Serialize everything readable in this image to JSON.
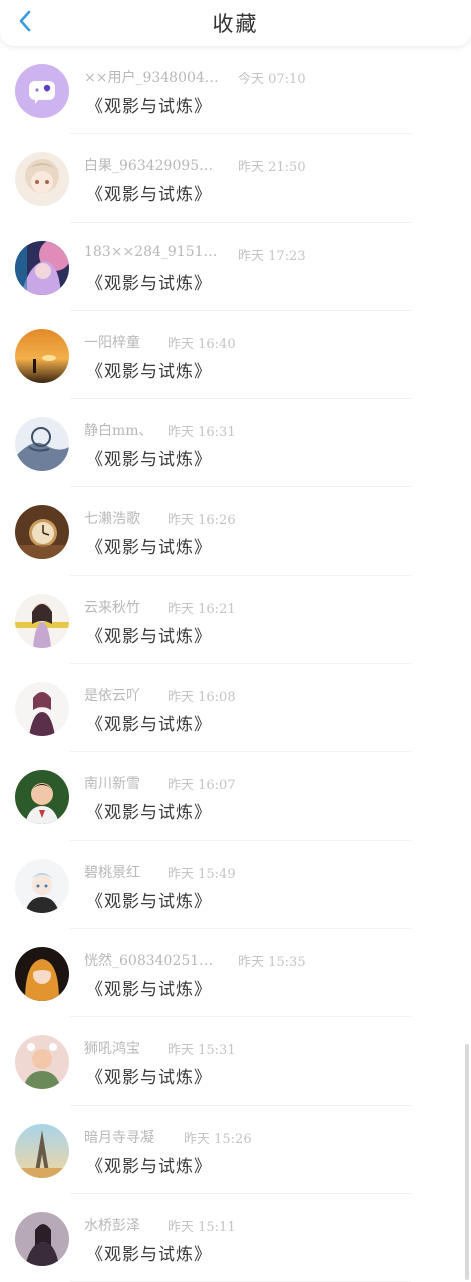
{
  "header": {
    "title": "收藏",
    "back_icon": "chevron-left-icon",
    "accent_color": "#3a9be0"
  },
  "work_title": "《观影与试炼》",
  "items": [
    {
      "name": "××用户_9348004…",
      "time": "今天 07:10"
    },
    {
      "name": "白果_963429095…",
      "time": "昨天 21:50"
    },
    {
      "name": "183××284_9151…",
      "time": "昨天 17:23"
    },
    {
      "name": "一阳梓童",
      "time": "昨天 16:40"
    },
    {
      "name": "静白mm、",
      "time": "昨天 16:31"
    },
    {
      "name": "七濑浩歌",
      "time": "昨天 16:26"
    },
    {
      "name": "云来秋竹",
      "time": "昨天 16:21"
    },
    {
      "name": "是依云吖",
      "time": "昨天 16:08"
    },
    {
      "name": "南川新雪",
      "time": "昨天 16:07"
    },
    {
      "name": "碧桃景红",
      "time": "昨天 15:49"
    },
    {
      "name": "恍然_608340251…",
      "time": "昨天 15:35"
    },
    {
      "name": "狮吼鸿宝",
      "time": "昨天 15:31"
    },
    {
      "name": "暗月寺寻凝",
      "time": "昨天 15:26"
    },
    {
      "name": "水桥彭泽",
      "time": "昨天 15:11"
    }
  ]
}
